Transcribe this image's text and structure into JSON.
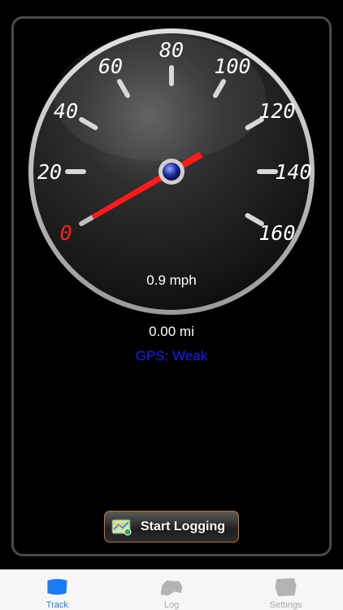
{
  "gauge": {
    "ticks": [
      "0",
      "20",
      "40",
      "60",
      "80",
      "100",
      "120",
      "140",
      "160"
    ],
    "needle_value": 0.9,
    "min": 0,
    "max": 160
  },
  "readout": {
    "speed": "0.9 mph",
    "distance": "0.00 mi",
    "gps_status": "GPS: Weak"
  },
  "logging": {
    "button_label": "Start Logging"
  },
  "tabbar": {
    "tabs": [
      {
        "label": "Track",
        "icon": "track-icon",
        "active": true
      },
      {
        "label": "Log",
        "icon": "log-icon",
        "active": false
      },
      {
        "label": "Settings",
        "icon": "settings-icon",
        "active": false
      }
    ]
  },
  "colors": {
    "tab_active": "#1b7bf4",
    "tab_inactive": "#a9a9a9",
    "gps_text": "#1a1aff",
    "needle": "#ff1a1a",
    "zero_tick": "#ff2020",
    "button_border": "#c0751f"
  }
}
